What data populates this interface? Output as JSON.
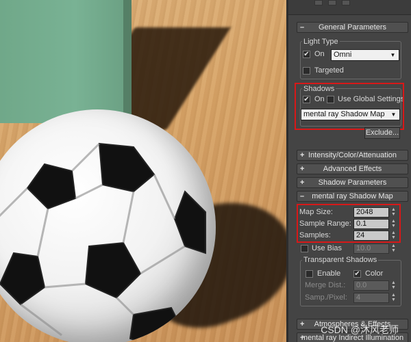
{
  "panel": {
    "general_parameters": {
      "header": "General Parameters",
      "light_type": {
        "group_title": "Light Type",
        "on_label": "On",
        "on_checked": true,
        "type_value": "Omni",
        "targeted_label": "Targeted",
        "targeted_checked": false
      },
      "shadows": {
        "group_title": "Shadows",
        "on_label": "On",
        "on_checked": true,
        "use_global_label": "Use Global Settings",
        "use_global_checked": false,
        "type_value": "mental ray Shadow Map",
        "exclude_button": "Exclude..."
      }
    },
    "collapsed_rollouts": [
      {
        "label": "Intensity/Color/Attenuation"
      },
      {
        "label": "Advanced Effects"
      },
      {
        "label": "Shadow Parameters"
      }
    ],
    "mental_ray_shadow_map": {
      "header": "mental ray Shadow Map",
      "map_size_label": "Map Size:",
      "map_size": "2048",
      "sample_range_label": "Sample Range:",
      "sample_range": "0.1",
      "samples_label": "Samples:",
      "samples": "24",
      "use_bias_label": "Use Bias",
      "use_bias_checked": false,
      "use_bias_value": "10.0",
      "transparent_shadows": {
        "group_title": "Transparent Shadows",
        "enable_label": "Enable",
        "enable_checked": false,
        "color_label": "Color",
        "color_checked": true,
        "merge_dist_label": "Merge Dist.:",
        "merge_dist": "0.0",
        "samp_pixel_label": "Samp./Pixel:",
        "samp_pixel": "4"
      }
    },
    "bottom_rollouts": [
      {
        "label": "Atmospheres & Effects"
      },
      {
        "label": "mental ray Indirect Illumination"
      }
    ]
  },
  "watermark": "CSDN @沐风老师",
  "colors": {
    "highlight_red": "#d81818",
    "panel_bg": "#444444",
    "floor": "#d7a468",
    "box_green": "#79b294"
  }
}
